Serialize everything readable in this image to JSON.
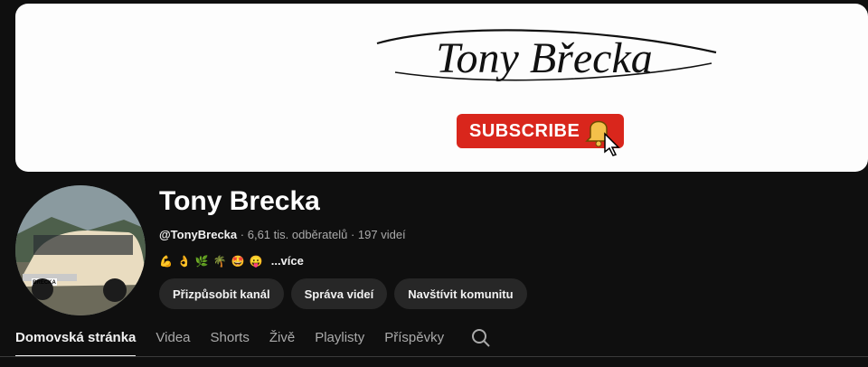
{
  "banner": {
    "logo_text": "Tony Břecka",
    "subscribe_label": "SUBSCRIBE"
  },
  "channel": {
    "name": "Tony Brecka",
    "handle": "@TonyBrecka",
    "subscribers": "6,61 tis. odběratelů",
    "videos": "197 videí",
    "sep": "·",
    "description_emojis": [
      "💪",
      "👌",
      "🌿",
      "🌴",
      "🤩",
      "😛"
    ],
    "more_label": "...více",
    "avatar_plate": "BRECKA"
  },
  "actions": [
    {
      "label": "Přizpůsobit kanál"
    },
    {
      "label": "Správa videí"
    },
    {
      "label": "Navštívit komunitu"
    }
  ],
  "tabs": [
    {
      "label": "Domovská stránka",
      "active": true
    },
    {
      "label": "Videa"
    },
    {
      "label": "Shorts"
    },
    {
      "label": "Živě"
    },
    {
      "label": "Playlisty"
    },
    {
      "label": "Příspěvky"
    }
  ],
  "icons": {
    "search": "search-icon",
    "bell": "bell-icon"
  },
  "colors": {
    "subscribe": "#d9261c",
    "background": "#0f0f0f",
    "button": "#272727"
  }
}
